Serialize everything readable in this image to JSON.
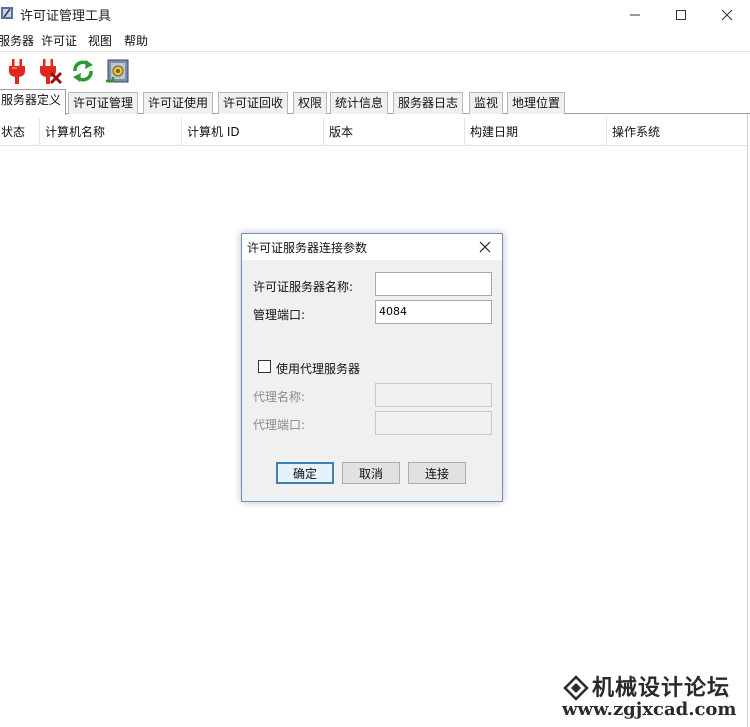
{
  "window": {
    "title": "许可证管理工具",
    "min_icon": "minimize-icon",
    "max_icon": "maximize-icon",
    "close_icon": "close-icon"
  },
  "menu": [
    "服务器",
    "许可证",
    "视图",
    "帮助"
  ],
  "toolbar": {
    "buttons": [
      "connect-plug-icon",
      "disconnect-plug-icon",
      "refresh-icon",
      "server-settings-icon"
    ]
  },
  "tabs": [
    "服务器定义",
    "许可证管理",
    "许可证使用",
    "许可证回收",
    "权限",
    "统计信息",
    "服务器日志",
    "监视",
    "地理位置"
  ],
  "active_tab": "服务器定义",
  "table": {
    "columns": [
      "状态",
      "计算机名称",
      "计算机 ID",
      "版本",
      "构建日期",
      "操作系统"
    ]
  },
  "dialog": {
    "title": "许可证服务器连接参数",
    "server_name_label": "许可证服务器名称:",
    "server_name_value": "",
    "port_label": "管理端口:",
    "port_value": "4084",
    "use_proxy_label": "使用代理服务器",
    "use_proxy_checked": false,
    "proxy_name_label": "代理名称:",
    "proxy_name_value": "",
    "proxy_port_label": "代理端口:",
    "proxy_port_value": "",
    "ok_label": "确定",
    "cancel_label": "取消",
    "connect_label": "连接"
  },
  "watermark": {
    "title": "机械设计论坛",
    "url": "www.zgjxcad.com"
  },
  "colors": {
    "dialog_border": "#6d8fc2",
    "default_button_border": "#3c7fb1",
    "plug_red": "#e1261c",
    "refresh_green": "#2e9a2e"
  }
}
